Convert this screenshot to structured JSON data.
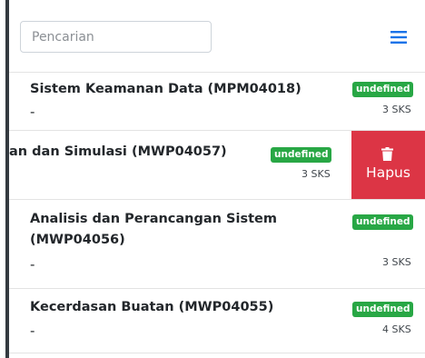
{
  "search": {
    "placeholder": "Pencarian"
  },
  "icons": {
    "menu": "hamburger-menu-icon",
    "delete": "trash-icon"
  },
  "colors": {
    "accent": "#1a73e8",
    "badge": "#28a745",
    "delete": "#dc3545",
    "sidebar": "#343a40"
  },
  "courses": [
    {
      "title": "Sistem Keamanan Data (MPM04018)",
      "subtitle": "-",
      "badge": "undefined",
      "sks": "3 SKS"
    },
    {
      "title": "an dan Simulasi (MWP04057)",
      "subtitle": "",
      "badge": "undefined",
      "sks": "3 SKS",
      "delete_label": "Hapus"
    },
    {
      "title": "Analisis dan Perancangan Sistem (MWP04056)",
      "subtitle": "-",
      "badge": "undefined",
      "sks": "3 SKS"
    },
    {
      "title": "Kecerdasan Buatan (MWP04055)",
      "subtitle": "-",
      "badge": "undefined",
      "sks": "4 SKS"
    }
  ]
}
